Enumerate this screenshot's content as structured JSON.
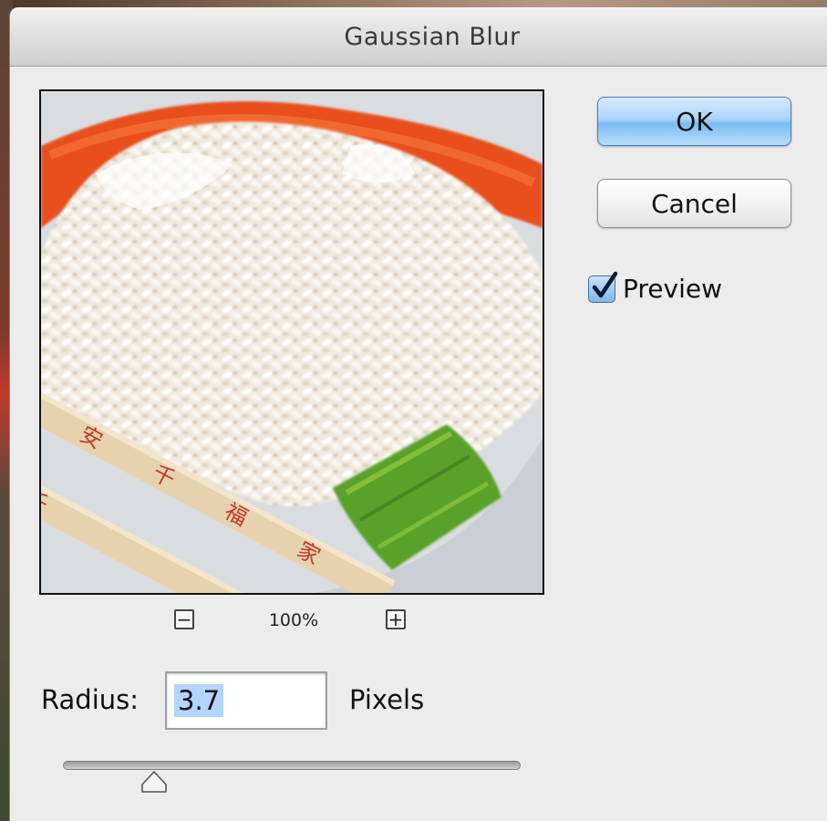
{
  "dialog": {
    "title": "Gaussian Blur"
  },
  "buttons": {
    "ok_label": "OK",
    "cancel_label": "Cancel"
  },
  "preview": {
    "label": "Preview",
    "checked": true
  },
  "zoom": {
    "level": "100%",
    "zoom_out_icon": "minus-icon",
    "zoom_in_icon": "plus-icon"
  },
  "radius": {
    "label": "Radius:",
    "value": "3.7",
    "units": "Pixels",
    "slider_fraction": 0.2
  },
  "colors": {
    "ok_button": "#9fcdf8",
    "selection": "#b3d4fc",
    "dialog_bg": "#ececec"
  }
}
